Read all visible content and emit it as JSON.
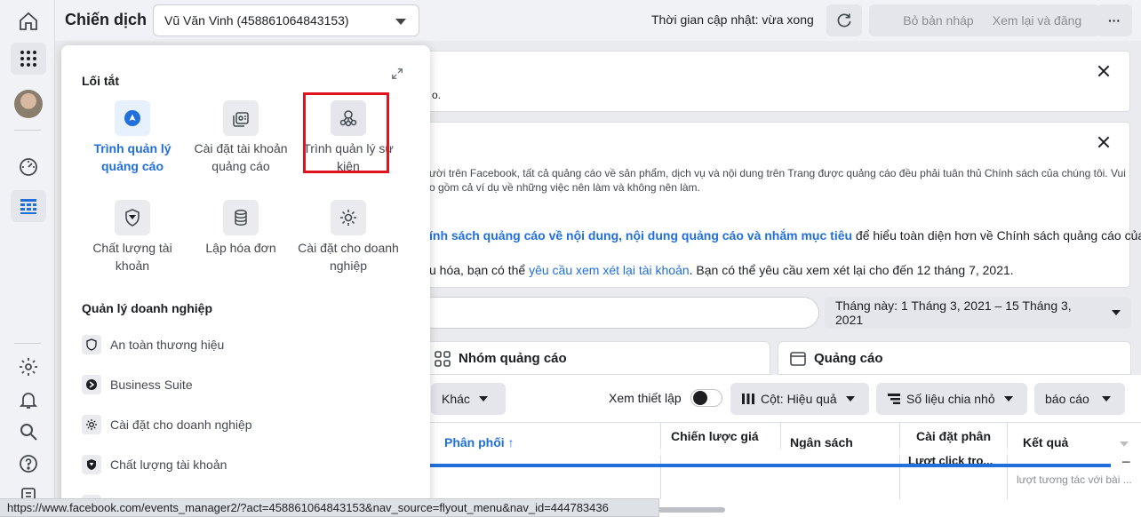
{
  "header": {
    "title": "Chiến dịch",
    "account_select": "Vũ Văn Vinh (458861064843153)",
    "update_text": "Thời gian cập nhật: vừa xong",
    "discard_draft": "Bỏ bản nháp",
    "review_publish": "Xem lại và đăng"
  },
  "notices": {
    "n1_tail": "o.",
    "n2_line1": "ười trên Facebook, tất cả quảng cáo về sản phẩm, dịch vụ và nội dung trên Trang được quảng cáo đều phải tuân thủ Chính sách của chúng tôi. Vui",
    "n2_line2": "o gồm cả ví dụ về những việc nên làm và không nên làm.",
    "n2_policy_link": "ính sách quảng cáo về nội dung, nội dung quảng cáo và nhắm mục tiêu",
    "n2_policy_rest": " để hiểu toàn diện hơn về Chính sách quảng cáo của",
    "n2_review_pre": "u hóa, bạn có thể ",
    "n2_review_link": "yêu cầu xem xét lại tài khoản",
    "n2_review_post": ". Bạn có thể yêu cầu xem xét lại cho đến 12 tháng 7, 2021."
  },
  "date_range": "Tháng này: 1 Tháng 3, 2021 – 15 Tháng 3, 2021",
  "tabs": {
    "adsets": "Nhóm quảng cáo",
    "ads": "Quảng cáo"
  },
  "toolbar": {
    "more": "Khác",
    "view_setup": "Xem thiết lập",
    "columns": "Cột: Hiệu quả",
    "breakdown": "Số liệu chia nhỏ",
    "reports": "báo cáo"
  },
  "table": {
    "headers": [
      "Phân phối ↑",
      "Chiến lược giá",
      "Ngân sách",
      "Cài đặt phân",
      "Kết quả"
    ],
    "cell_click": "Lượt click trọ...",
    "cell_engagement": "lượt tương tác với bài ..."
  },
  "flyout": {
    "shortcuts_title": "Lối tắt",
    "shortcuts": [
      {
        "label": "Trình quản lý quảng cáo",
        "icon": "ads-manager-icon"
      },
      {
        "label": "Cài đặt tài khoản quảng cáo",
        "icon": "ad-account-settings-icon"
      },
      {
        "label": "Trình quản lý sự kiện",
        "icon": "events-manager-icon"
      },
      {
        "label": "Chất lượng tài khoản",
        "icon": "account-quality-icon"
      },
      {
        "label": "Lập hóa đơn",
        "icon": "billing-icon"
      },
      {
        "label": "Cài đặt cho doanh nghiệp",
        "icon": "business-settings-icon"
      }
    ],
    "business_title": "Quản lý doanh nghiệp",
    "business_items": [
      {
        "label": "An toàn thương hiệu",
        "icon": "brand-safety-icon"
      },
      {
        "label": "Business Suite",
        "icon": "business-suite-icon"
      },
      {
        "label": "Cài đặt cho doanh nghiệp",
        "icon": "gear-icon"
      },
      {
        "label": "Chất lượng tài khoản",
        "icon": "account-quality-icon"
      }
    ]
  },
  "status_url": "https://www.facebook.com/events_manager2/?act=458861064843153&nav_source=flyout_menu&nav_id=444783436",
  "colors": {
    "accent": "#216fdb",
    "highlight": "#e0141e"
  }
}
